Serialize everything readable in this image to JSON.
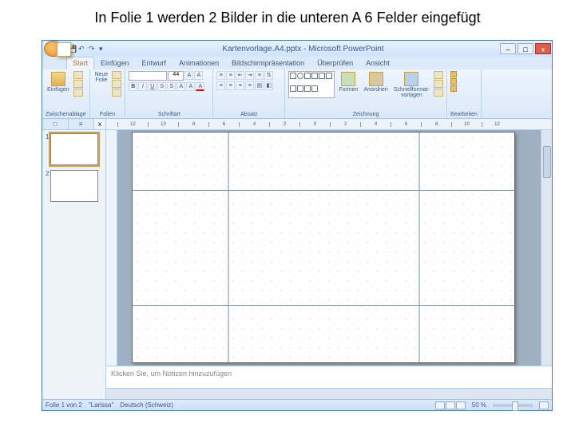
{
  "caption": "In Folie 1 werden 2 Bilder in die unteren A 6 Felder eingefügt",
  "titlebar": {
    "title": "Kartenvorlage.A4.pptx - Microsoft PowerPoint",
    "min": "–",
    "max": "□",
    "close": "x"
  },
  "tabs": [
    "Start",
    "Einfügen",
    "Entwurf",
    "Animationen",
    "Bildschirmpräsentation",
    "Überprüfen",
    "Ansicht"
  ],
  "ribbon": {
    "paste": "Einfügen",
    "clipboard_label": "Zwischenablage",
    "newslide": "Neue\nFolie",
    "slides_label": "Folien",
    "font_size": "44",
    "font_label": "Schriftart",
    "para_label": "Absatz",
    "shapes": "Formen",
    "arrange": "Anordnen",
    "quick": "Schnellformat-\nvorlagen",
    "draw_label": "Zeichnung",
    "edit_label": "Bearbeiten"
  },
  "outline": {
    "tab1": "□",
    "tab2": "≡",
    "close": "x",
    "n1": "1",
    "n2": "2"
  },
  "ruler": [
    "12",
    "10",
    "8",
    "6",
    "4",
    "2",
    "0",
    "2",
    "4",
    "6",
    "8",
    "10",
    "12"
  ],
  "notes": "Klicken Sie, um Notizen hinzuzufügen",
  "status": {
    "slide": "Folie 1 von 2",
    "theme": "\"Larissa\"",
    "lang": "Deutsch (Schweiz)",
    "zoom": "50 %"
  }
}
